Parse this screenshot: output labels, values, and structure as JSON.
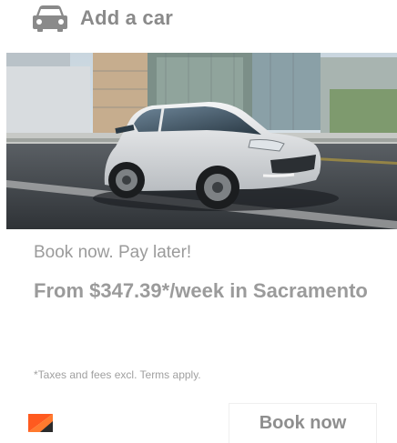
{
  "header": {
    "icon": "car-icon",
    "title": "Add a car"
  },
  "hero": {
    "image": "white-suv-on-city-street"
  },
  "offer": {
    "tagline": "Book now. Pay later!",
    "price_line": "From $347.39*/week in Sacramento",
    "disclaimer": "*Taxes and fees excl. Terms apply."
  },
  "footer": {
    "logo": "brand-logo-icon",
    "book_label": "Book now"
  },
  "colors": {
    "text_muted": "#9b9b9b",
    "logo_orange": "#ff5a1f",
    "logo_dark": "#2b2b2b"
  }
}
